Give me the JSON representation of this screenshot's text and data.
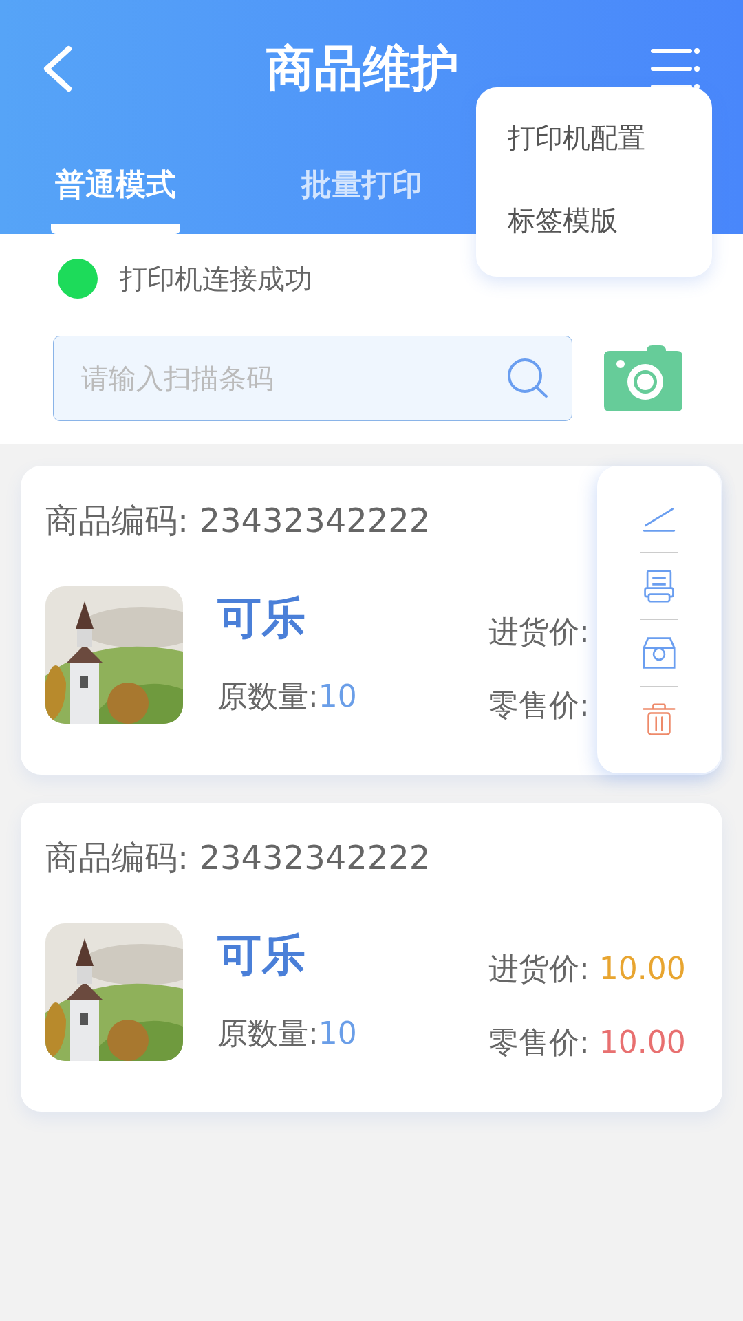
{
  "header": {
    "title": "商品维护"
  },
  "tabs": [
    {
      "label": "普通模式",
      "selected": true
    },
    {
      "label": "批量打印",
      "selected": false
    }
  ],
  "dropdown_menu": {
    "items": [
      "打印机配置",
      "标签模版"
    ]
  },
  "printer_status": {
    "connected": true,
    "text": "打印机连接成功"
  },
  "search": {
    "placeholder": "请输入扫描条码"
  },
  "products": [
    {
      "code_label": "商品编码:",
      "code": "23432342222",
      "name": "可乐",
      "quantity_label": "原数量:",
      "quantity": "10",
      "purchase_label": "进货价:",
      "retail_label": "零售价:",
      "actions": [
        {
          "kind": "edit"
        },
        {
          "kind": "print"
        },
        {
          "kind": "store"
        },
        {
          "kind": "delete"
        }
      ]
    },
    {
      "code_label": "商品编码:",
      "code": "23432342222",
      "name": "可乐",
      "quantity_label": "原数量:",
      "quantity": "10",
      "purchase_label": "进货价:",
      "purchase_price": "10.00",
      "retail_label": "零售价:",
      "retail_price": "10.00"
    }
  ]
}
